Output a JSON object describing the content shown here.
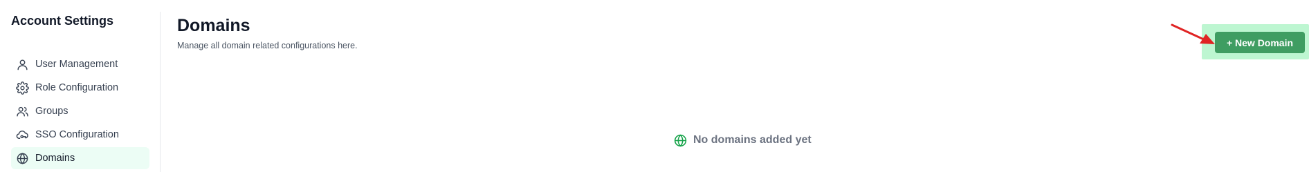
{
  "sidebar": {
    "title": "Account Settings",
    "items": [
      {
        "label": "User Management",
        "icon": "user-icon",
        "active": false
      },
      {
        "label": "Role Configuration",
        "icon": "gear-icon",
        "active": false
      },
      {
        "label": "Groups",
        "icon": "users-icon",
        "active": false
      },
      {
        "label": "SSO Configuration",
        "icon": "cloud-key-icon",
        "active": false
      },
      {
        "label": "Domains",
        "icon": "globe-icon",
        "active": true
      }
    ]
  },
  "main": {
    "title": "Domains",
    "subtitle": "Manage all domain related configurations here.",
    "new_button_label": "+ New Domain",
    "empty_state": {
      "text": "No domains added yet",
      "icon": "globe-icon"
    }
  },
  "colors": {
    "accent": "#3f9d62",
    "active_bg": "#ecfdf5",
    "highlight": "#86efac",
    "annotation_arrow": "#e02424",
    "empty_icon": "#16a34a"
  }
}
